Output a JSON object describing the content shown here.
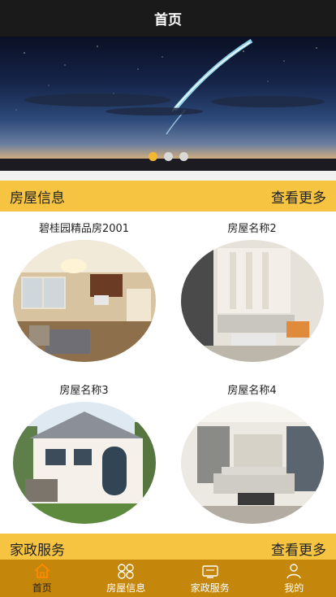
{
  "header": {
    "title": "首页"
  },
  "banner": {
    "dots": 3,
    "active_index": 0,
    "accent": "#f4b731"
  },
  "house_section": {
    "title": "房屋信息",
    "more": "查看更多",
    "items": [
      {
        "name": "碧桂园精品房2001"
      },
      {
        "name": "房屋名称2"
      },
      {
        "name": "房屋名称3"
      },
      {
        "name": "房屋名称4"
      }
    ]
  },
  "service_section": {
    "title": "家政服务",
    "more": "查看更多"
  },
  "tabbar": {
    "items": [
      {
        "label": "首页",
        "icon": "home-icon",
        "active": true
      },
      {
        "label": "房屋信息",
        "icon": "grid-icon",
        "active": false
      },
      {
        "label": "家政服务",
        "icon": "tv-icon",
        "active": false
      },
      {
        "label": "我的",
        "icon": "user-icon",
        "active": false
      }
    ]
  },
  "colors": {
    "section_bg": "#f6c441",
    "tabbar_bg": "#c5870b",
    "header_bg": "#1a1a1a"
  }
}
